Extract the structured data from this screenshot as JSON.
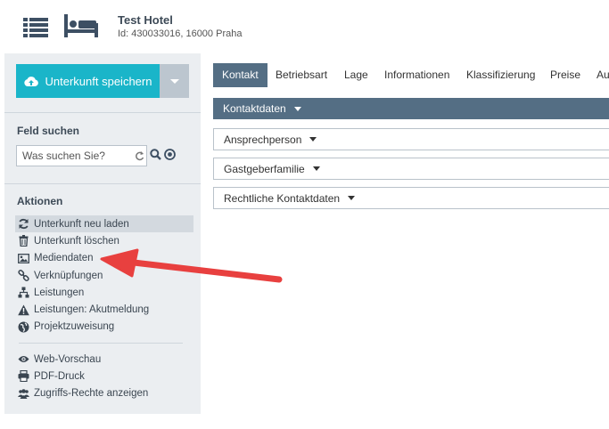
{
  "header": {
    "title": "Test Hotel",
    "subtitle": "Id: 430033016, 16000 Praha"
  },
  "sidebar": {
    "save_label": "Unterkunft speichern",
    "search_title": "Feld suchen",
    "search_placeholder": "Was suchen Sie?",
    "actions_title": "Aktionen",
    "actions": [
      {
        "label": "Unterkunft neu laden",
        "icon": "refresh-icon"
      },
      {
        "label": "Unterkunft löschen",
        "icon": "trash-icon"
      },
      {
        "label": "Mediendaten",
        "icon": "image-icon"
      },
      {
        "label": "Verknüpfungen",
        "icon": "link-icon"
      },
      {
        "label": "Leistungen",
        "icon": "sitemap-icon"
      },
      {
        "label": "Leistungen: Akutmeldung",
        "icon": "warning-icon"
      },
      {
        "label": "Projektzuweisung",
        "icon": "globe-icon"
      }
    ],
    "actions2": [
      {
        "label": "Web-Vorschau",
        "icon": "eye-icon"
      },
      {
        "label": "PDF-Druck",
        "icon": "print-icon"
      },
      {
        "label": "Zugriffs-Rechte anzeigen",
        "icon": "users-icon"
      }
    ]
  },
  "tabs": [
    "Kontakt",
    "Betriebsart",
    "Lage",
    "Informationen",
    "Klassifizierung",
    "Preise",
    "Aus"
  ],
  "panels": {
    "open": "Kontaktdaten",
    "collapsed": [
      "Ansprechperson",
      "Gastgeberfamilie",
      "Rechtliche Kontaktdaten"
    ]
  },
  "colors": {
    "accent": "#1ab5c9",
    "panel_header": "#546e84",
    "sidebar_bg": "#ebeef1",
    "annotation_arrow": "#e8403f"
  }
}
